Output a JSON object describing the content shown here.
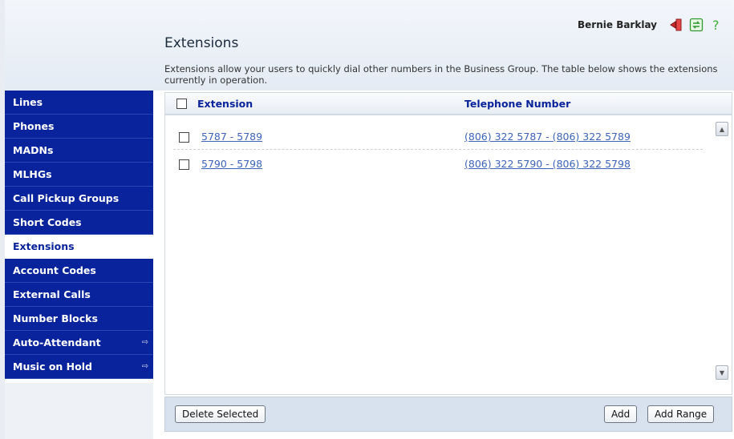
{
  "header": {
    "user_name": "Bernie Barklay",
    "icons": [
      "logout-icon",
      "refresh-icon",
      "help-icon"
    ],
    "page_title": "Extensions",
    "description": "Extensions allow your users to quickly dial other numbers in the Business Group. The table below shows the extensions currently in operation."
  },
  "sidebar": {
    "items": [
      {
        "label": "Lines",
        "active": false
      },
      {
        "label": "Phones",
        "active": false
      },
      {
        "label": "MADNs",
        "active": false
      },
      {
        "label": "MLHGs",
        "active": false
      },
      {
        "label": "Call Pickup Groups",
        "active": false
      },
      {
        "label": "Short Codes",
        "active": false
      },
      {
        "label": "Extensions",
        "active": true
      },
      {
        "label": "Account Codes",
        "active": false
      },
      {
        "label": "External Calls",
        "active": false
      },
      {
        "label": "Number Blocks",
        "active": false
      },
      {
        "label": "Auto-Attendant",
        "active": false,
        "external": "⇨"
      },
      {
        "label": "Music on Hold",
        "active": false,
        "external": "⇨"
      }
    ]
  },
  "table": {
    "columns": {
      "extension": "Extension",
      "telephone": "Telephone Number"
    },
    "rows": [
      {
        "extension": "5787 - 5789",
        "telephone": "(806) 322 5787 - (806) 322 5789"
      },
      {
        "extension": "5790 - 5798",
        "telephone": "(806) 322 5790 - (806) 322 5798"
      }
    ]
  },
  "footer": {
    "delete_label": "Delete Selected",
    "add_label": "Add",
    "add_range_label": "Add Range"
  },
  "colors": {
    "nav_bg": "#08239b",
    "link": "#3d63b8",
    "header_text": "#08239b"
  }
}
